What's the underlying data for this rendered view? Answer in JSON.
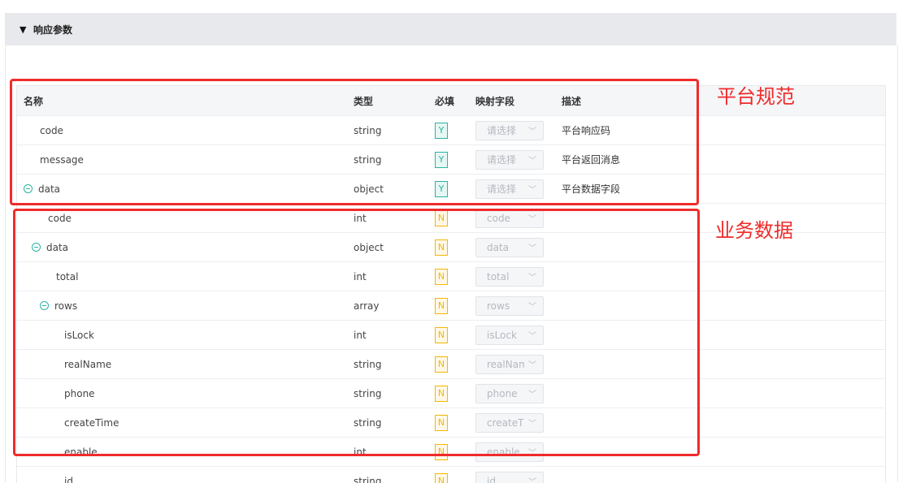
{
  "panel": {
    "caret": "▼",
    "title": "响应参数"
  },
  "columns": {
    "name": "名称",
    "type": "类型",
    "required": "必填",
    "mapping": "映射字段",
    "desc": "描述"
  },
  "rows": [
    {
      "name": "code",
      "type": "string",
      "required": "Y",
      "mapping": "请选择",
      "desc": "平台响应码",
      "expandable": false
    },
    {
      "name": "message",
      "type": "string",
      "required": "Y",
      "mapping": "请选择",
      "desc": "平台返回消息",
      "expandable": false
    },
    {
      "name": "data",
      "type": "object",
      "required": "Y",
      "mapping": "请选择",
      "desc": "平台数据字段",
      "expandable": true
    },
    {
      "name": "code",
      "type": "int",
      "required": "N",
      "mapping": "code",
      "desc": "",
      "expandable": false
    },
    {
      "name": "data",
      "type": "object",
      "required": "N",
      "mapping": "data",
      "desc": "",
      "expandable": true
    },
    {
      "name": "total",
      "type": "int",
      "required": "N",
      "mapping": "total",
      "desc": "",
      "expandable": false
    },
    {
      "name": "rows",
      "type": "array",
      "required": "N",
      "mapping": "rows",
      "desc": "",
      "expandable": true
    },
    {
      "name": "isLock",
      "type": "int",
      "required": "N",
      "mapping": "isLock",
      "desc": "",
      "expandable": false
    },
    {
      "name": "realName",
      "type": "string",
      "required": "N",
      "mapping": "realName",
      "desc": "",
      "expandable": false
    },
    {
      "name": "phone",
      "type": "string",
      "required": "N",
      "mapping": "phone",
      "desc": "",
      "expandable": false
    },
    {
      "name": "createTime",
      "type": "string",
      "required": "N",
      "mapping": "createTime",
      "desc": "",
      "expandable": false
    },
    {
      "name": "enable",
      "type": "int",
      "required": "N",
      "mapping": "enable",
      "desc": "",
      "expandable": false
    },
    {
      "name": "id",
      "type": "string",
      "required": "N",
      "mapping": "id",
      "desc": "",
      "expandable": false
    }
  ],
  "annotations": {
    "platform": "平台规范",
    "business": "业务数据"
  },
  "colors": {
    "annotation_red": "#f02b2b",
    "required_yes": "#2bb3a3",
    "required_no": "#f2b705",
    "header_bg": "#e8e9ec"
  },
  "icons": {
    "collapse": "minus-circle-icon",
    "dropdown": "chevron-down-icon",
    "caret": "caret-down-icon"
  }
}
